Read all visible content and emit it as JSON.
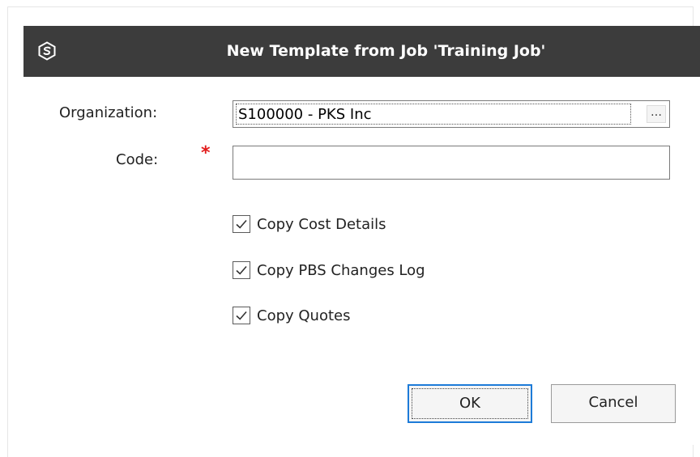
{
  "dialog": {
    "title": "New Template from Job 'Training Job'",
    "icon": "app-logo-icon"
  },
  "form": {
    "organization_label": "Organization:",
    "organization_value": "S100000 - PKS Inc",
    "organization_browse": "…",
    "code_label": "Code:",
    "code_required_mark": "*",
    "code_value": ""
  },
  "options": [
    {
      "label": "Copy Cost Details",
      "checked": true
    },
    {
      "label": "Copy PBS Changes Log",
      "checked": true
    },
    {
      "label": "Copy Quotes",
      "checked": true
    }
  ],
  "buttons": {
    "ok": "OK",
    "cancel": "Cancel"
  },
  "colors": {
    "titlebar": "#3c3c3c",
    "required": "#e21b1b",
    "focus_border": "#1d7bd8"
  }
}
